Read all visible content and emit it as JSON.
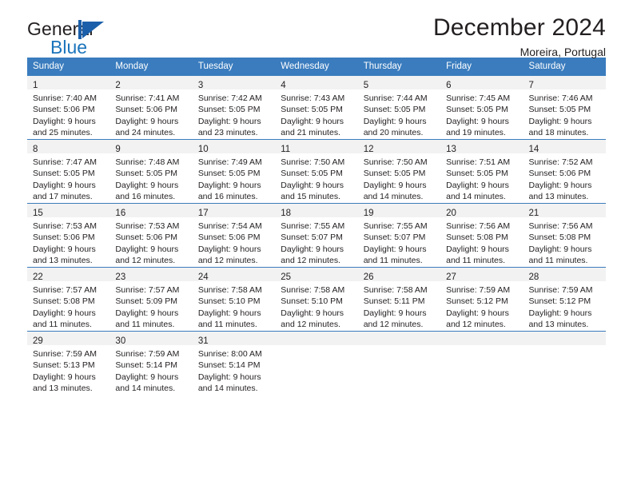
{
  "brand": {
    "name_part1": "General",
    "name_part2": "Blue",
    "mark": "sailboat-logo"
  },
  "header": {
    "month_title": "December 2024",
    "location": "Moreira, Portugal"
  },
  "theme": {
    "header_blue": "#3a7cbe",
    "brand_blue": "#1b74bb",
    "daynum_band": "#f2f2f2",
    "text": "#231f20"
  },
  "weekday_headers": [
    "Sunday",
    "Monday",
    "Tuesday",
    "Wednesday",
    "Thursday",
    "Friday",
    "Saturday"
  ],
  "weeks": [
    [
      {
        "day": "1",
        "sunrise": "Sunrise: 7:40 AM",
        "sunset": "Sunset: 5:06 PM",
        "daylight1": "Daylight: 9 hours",
        "daylight2": "and 25 minutes."
      },
      {
        "day": "2",
        "sunrise": "Sunrise: 7:41 AM",
        "sunset": "Sunset: 5:06 PM",
        "daylight1": "Daylight: 9 hours",
        "daylight2": "and 24 minutes."
      },
      {
        "day": "3",
        "sunrise": "Sunrise: 7:42 AM",
        "sunset": "Sunset: 5:05 PM",
        "daylight1": "Daylight: 9 hours",
        "daylight2": "and 23 minutes."
      },
      {
        "day": "4",
        "sunrise": "Sunrise: 7:43 AM",
        "sunset": "Sunset: 5:05 PM",
        "daylight1": "Daylight: 9 hours",
        "daylight2": "and 21 minutes."
      },
      {
        "day": "5",
        "sunrise": "Sunrise: 7:44 AM",
        "sunset": "Sunset: 5:05 PM",
        "daylight1": "Daylight: 9 hours",
        "daylight2": "and 20 minutes."
      },
      {
        "day": "6",
        "sunrise": "Sunrise: 7:45 AM",
        "sunset": "Sunset: 5:05 PM",
        "daylight1": "Daylight: 9 hours",
        "daylight2": "and 19 minutes."
      },
      {
        "day": "7",
        "sunrise": "Sunrise: 7:46 AM",
        "sunset": "Sunset: 5:05 PM",
        "daylight1": "Daylight: 9 hours",
        "daylight2": "and 18 minutes."
      }
    ],
    [
      {
        "day": "8",
        "sunrise": "Sunrise: 7:47 AM",
        "sunset": "Sunset: 5:05 PM",
        "daylight1": "Daylight: 9 hours",
        "daylight2": "and 17 minutes."
      },
      {
        "day": "9",
        "sunrise": "Sunrise: 7:48 AM",
        "sunset": "Sunset: 5:05 PM",
        "daylight1": "Daylight: 9 hours",
        "daylight2": "and 16 minutes."
      },
      {
        "day": "10",
        "sunrise": "Sunrise: 7:49 AM",
        "sunset": "Sunset: 5:05 PM",
        "daylight1": "Daylight: 9 hours",
        "daylight2": "and 16 minutes."
      },
      {
        "day": "11",
        "sunrise": "Sunrise: 7:50 AM",
        "sunset": "Sunset: 5:05 PM",
        "daylight1": "Daylight: 9 hours",
        "daylight2": "and 15 minutes."
      },
      {
        "day": "12",
        "sunrise": "Sunrise: 7:50 AM",
        "sunset": "Sunset: 5:05 PM",
        "daylight1": "Daylight: 9 hours",
        "daylight2": "and 14 minutes."
      },
      {
        "day": "13",
        "sunrise": "Sunrise: 7:51 AM",
        "sunset": "Sunset: 5:05 PM",
        "daylight1": "Daylight: 9 hours",
        "daylight2": "and 14 minutes."
      },
      {
        "day": "14",
        "sunrise": "Sunrise: 7:52 AM",
        "sunset": "Sunset: 5:06 PM",
        "daylight1": "Daylight: 9 hours",
        "daylight2": "and 13 minutes."
      }
    ],
    [
      {
        "day": "15",
        "sunrise": "Sunrise: 7:53 AM",
        "sunset": "Sunset: 5:06 PM",
        "daylight1": "Daylight: 9 hours",
        "daylight2": "and 13 minutes."
      },
      {
        "day": "16",
        "sunrise": "Sunrise: 7:53 AM",
        "sunset": "Sunset: 5:06 PM",
        "daylight1": "Daylight: 9 hours",
        "daylight2": "and 12 minutes."
      },
      {
        "day": "17",
        "sunrise": "Sunrise: 7:54 AM",
        "sunset": "Sunset: 5:06 PM",
        "daylight1": "Daylight: 9 hours",
        "daylight2": "and 12 minutes."
      },
      {
        "day": "18",
        "sunrise": "Sunrise: 7:55 AM",
        "sunset": "Sunset: 5:07 PM",
        "daylight1": "Daylight: 9 hours",
        "daylight2": "and 12 minutes."
      },
      {
        "day": "19",
        "sunrise": "Sunrise: 7:55 AM",
        "sunset": "Sunset: 5:07 PM",
        "daylight1": "Daylight: 9 hours",
        "daylight2": "and 11 minutes."
      },
      {
        "day": "20",
        "sunrise": "Sunrise: 7:56 AM",
        "sunset": "Sunset: 5:08 PM",
        "daylight1": "Daylight: 9 hours",
        "daylight2": "and 11 minutes."
      },
      {
        "day": "21",
        "sunrise": "Sunrise: 7:56 AM",
        "sunset": "Sunset: 5:08 PM",
        "daylight1": "Daylight: 9 hours",
        "daylight2": "and 11 minutes."
      }
    ],
    [
      {
        "day": "22",
        "sunrise": "Sunrise: 7:57 AM",
        "sunset": "Sunset: 5:08 PM",
        "daylight1": "Daylight: 9 hours",
        "daylight2": "and 11 minutes."
      },
      {
        "day": "23",
        "sunrise": "Sunrise: 7:57 AM",
        "sunset": "Sunset: 5:09 PM",
        "daylight1": "Daylight: 9 hours",
        "daylight2": "and 11 minutes."
      },
      {
        "day": "24",
        "sunrise": "Sunrise: 7:58 AM",
        "sunset": "Sunset: 5:10 PM",
        "daylight1": "Daylight: 9 hours",
        "daylight2": "and 11 minutes."
      },
      {
        "day": "25",
        "sunrise": "Sunrise: 7:58 AM",
        "sunset": "Sunset: 5:10 PM",
        "daylight1": "Daylight: 9 hours",
        "daylight2": "and 12 minutes."
      },
      {
        "day": "26",
        "sunrise": "Sunrise: 7:58 AM",
        "sunset": "Sunset: 5:11 PM",
        "daylight1": "Daylight: 9 hours",
        "daylight2": "and 12 minutes."
      },
      {
        "day": "27",
        "sunrise": "Sunrise: 7:59 AM",
        "sunset": "Sunset: 5:12 PM",
        "daylight1": "Daylight: 9 hours",
        "daylight2": "and 12 minutes."
      },
      {
        "day": "28",
        "sunrise": "Sunrise: 7:59 AM",
        "sunset": "Sunset: 5:12 PM",
        "daylight1": "Daylight: 9 hours",
        "daylight2": "and 13 minutes."
      }
    ],
    [
      {
        "day": "29",
        "sunrise": "Sunrise: 7:59 AM",
        "sunset": "Sunset: 5:13 PM",
        "daylight1": "Daylight: 9 hours",
        "daylight2": "and 13 minutes."
      },
      {
        "day": "30",
        "sunrise": "Sunrise: 7:59 AM",
        "sunset": "Sunset: 5:14 PM",
        "daylight1": "Daylight: 9 hours",
        "daylight2": "and 14 minutes."
      },
      {
        "day": "31",
        "sunrise": "Sunrise: 8:00 AM",
        "sunset": "Sunset: 5:14 PM",
        "daylight1": "Daylight: 9 hours",
        "daylight2": "and 14 minutes."
      },
      {
        "day": "",
        "sunrise": "",
        "sunset": "",
        "daylight1": "",
        "daylight2": ""
      },
      {
        "day": "",
        "sunrise": "",
        "sunset": "",
        "daylight1": "",
        "daylight2": ""
      },
      {
        "day": "",
        "sunrise": "",
        "sunset": "",
        "daylight1": "",
        "daylight2": ""
      },
      {
        "day": "",
        "sunrise": "",
        "sunset": "",
        "daylight1": "",
        "daylight2": ""
      }
    ]
  ]
}
